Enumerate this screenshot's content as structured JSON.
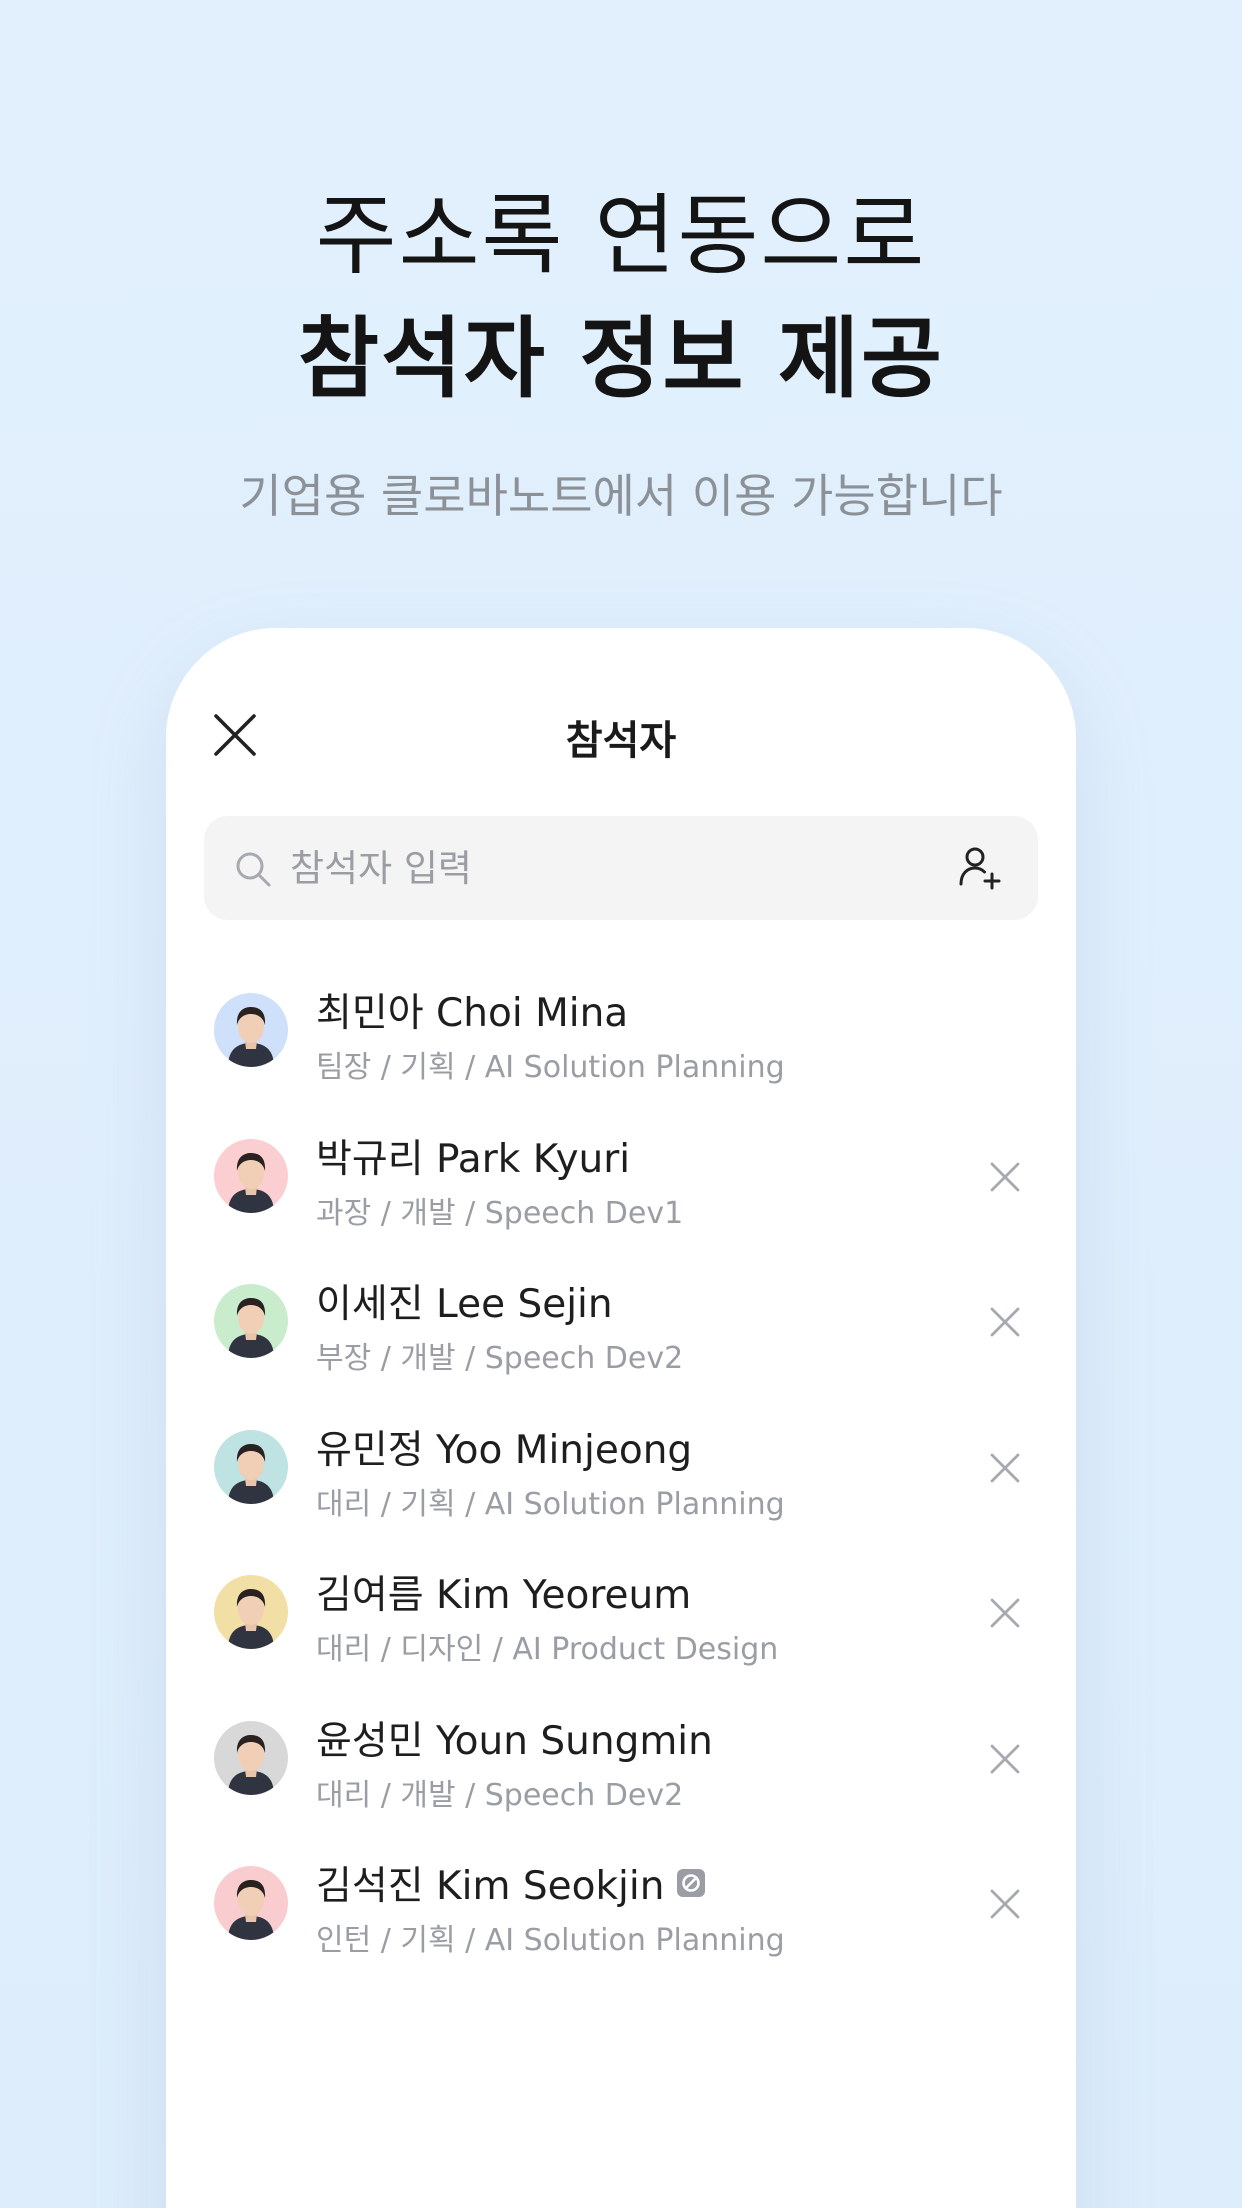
{
  "hero": {
    "line1": "주소록 연동으로",
    "line2": "참석자 정보 제공",
    "subtitle": "기업용 클로바노트에서 이용 가능합니다"
  },
  "sheet": {
    "title": "참석자",
    "search_placeholder": "참석자 입력"
  },
  "participants": [
    {
      "name": "최민아 Choi Mina",
      "role": "팀장 / 기획 / AI Solution Planning",
      "avatar_bg": "#cfe0fb",
      "removable": false
    },
    {
      "name": "박규리 Park Kyuri",
      "role": "과장 / 개발 / Speech Dev1",
      "avatar_bg": "#fbcfd2",
      "removable": true
    },
    {
      "name": "이세진 Lee Sejin",
      "role": "부장 / 개발 / Speech Dev2",
      "avatar_bg": "#c9eccd",
      "removable": true
    },
    {
      "name": "유민정 Yoo Minjeong",
      "role": "대리 / 기획 / AI Solution Planning",
      "avatar_bg": "#bfe3e3",
      "removable": true
    },
    {
      "name": "김여름 Kim Yeoreum",
      "role": "대리 / 디자인 / AI Product Design",
      "avatar_bg": "#f2dfa5",
      "removable": true
    },
    {
      "name": "윤성민 Youn Sungmin",
      "role": "대리 / 개발 / Speech Dev2",
      "avatar_bg": "#d8d8d8",
      "removable": true
    },
    {
      "name": "김석진 Kim Seokjin",
      "role": "인턴 / 기획 / AI Solution Planning",
      "avatar_bg": "#f9cdd0",
      "removable": true,
      "badge": "blocked-badge-icon"
    }
  ],
  "colors": {
    "background": "#e1effd",
    "headline": "#141414",
    "subtitle": "#8c9197",
    "secondary_text": "#9a9ea4"
  }
}
